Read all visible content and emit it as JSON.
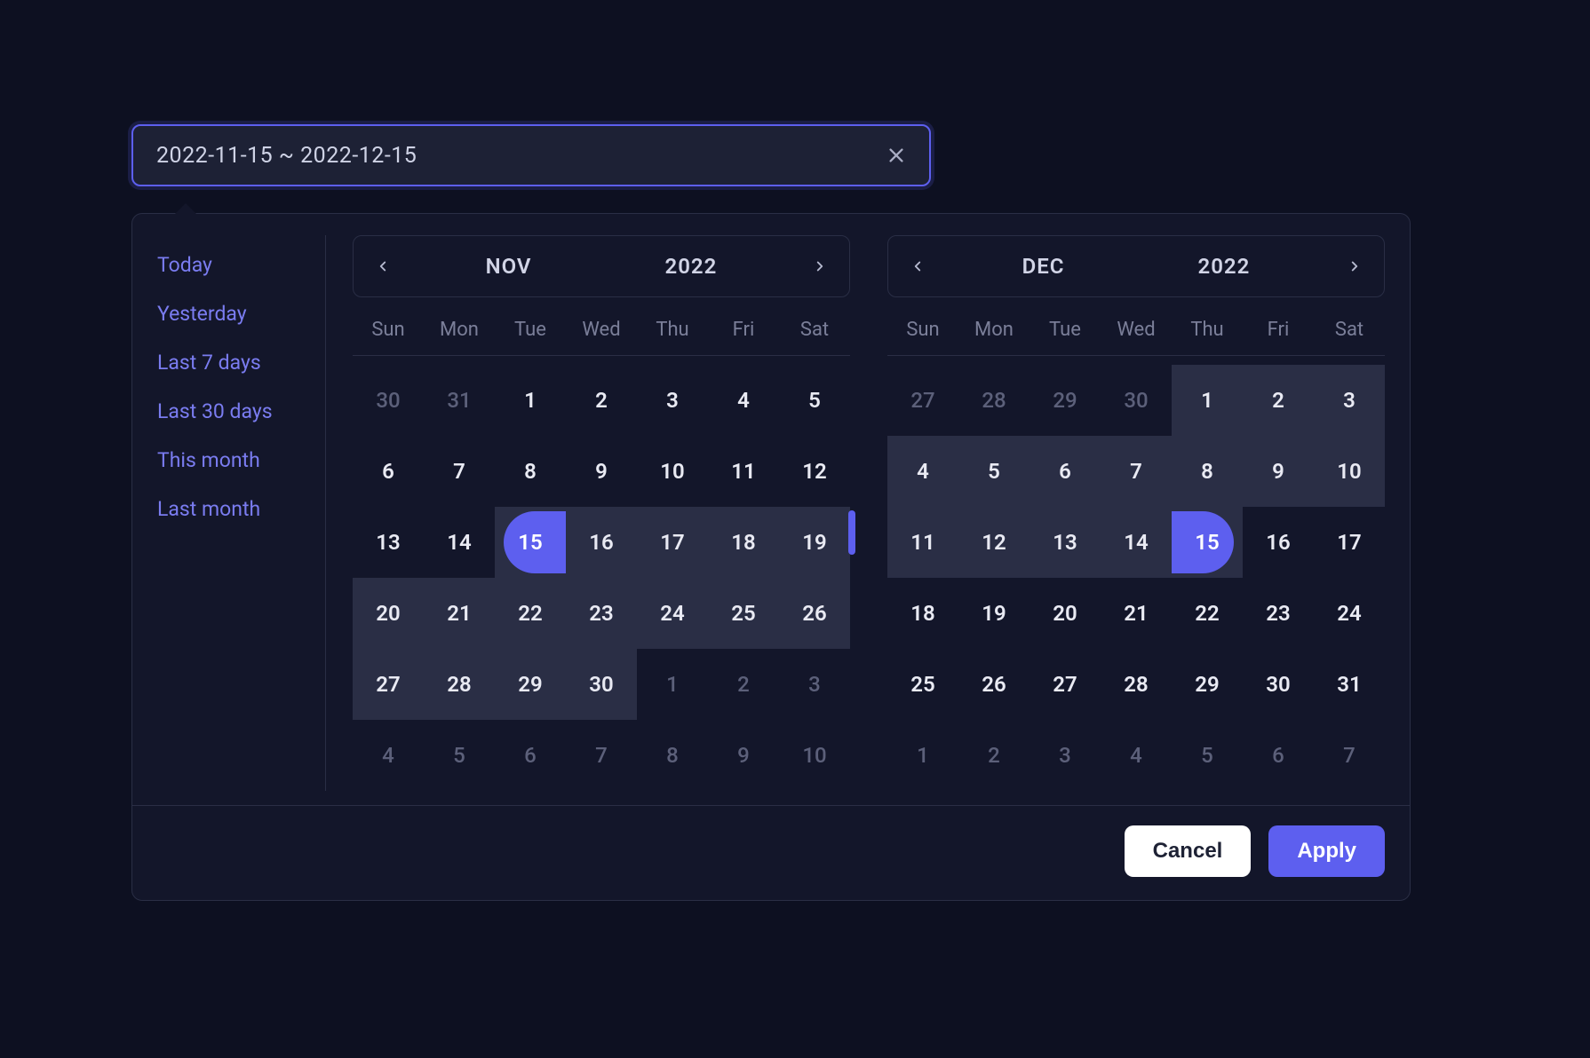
{
  "input": {
    "value": "2022-11-15 ~ 2022-12-15"
  },
  "shortcuts": [
    "Today",
    "Yesterday",
    "Last 7 days",
    "Last 30 days",
    "This month",
    "Last month"
  ],
  "leftCal": {
    "month": "NOV",
    "year": "2022",
    "dows": [
      "Sun",
      "Mon",
      "Tue",
      "Wed",
      "Thu",
      "Fri",
      "Sat"
    ],
    "cells": [
      {
        "n": 30,
        "out": true
      },
      {
        "n": 31,
        "out": true
      },
      {
        "n": 1
      },
      {
        "n": 2
      },
      {
        "n": 3
      },
      {
        "n": 4
      },
      {
        "n": 5
      },
      {
        "n": 6
      },
      {
        "n": 7
      },
      {
        "n": 8
      },
      {
        "n": 9
      },
      {
        "n": 10
      },
      {
        "n": 11
      },
      {
        "n": 12
      },
      {
        "n": 13
      },
      {
        "n": 14
      },
      {
        "n": 15,
        "selStart": true
      },
      {
        "n": 16,
        "range": true
      },
      {
        "n": 17,
        "range": true
      },
      {
        "n": 18,
        "range": true
      },
      {
        "n": 19,
        "range": true
      },
      {
        "n": 20,
        "range": true
      },
      {
        "n": 21,
        "range": true
      },
      {
        "n": 22,
        "range": true
      },
      {
        "n": 23,
        "range": true
      },
      {
        "n": 24,
        "range": true
      },
      {
        "n": 25,
        "range": true
      },
      {
        "n": 26,
        "range": true
      },
      {
        "n": 27,
        "range": true
      },
      {
        "n": 28,
        "range": true
      },
      {
        "n": 29,
        "range": true
      },
      {
        "n": 30,
        "range": true
      },
      {
        "n": 1,
        "out": true
      },
      {
        "n": 2,
        "out": true
      },
      {
        "n": 3,
        "out": true
      },
      {
        "n": 4,
        "out": true
      },
      {
        "n": 5,
        "out": true
      },
      {
        "n": 6,
        "out": true
      },
      {
        "n": 7,
        "out": true
      },
      {
        "n": 8,
        "out": true
      },
      {
        "n": 9,
        "out": true
      },
      {
        "n": 10,
        "out": true
      }
    ]
  },
  "rightCal": {
    "month": "DEC",
    "year": "2022",
    "dows": [
      "Sun",
      "Mon",
      "Tue",
      "Wed",
      "Thu",
      "Fri",
      "Sat"
    ],
    "cells": [
      {
        "n": 27,
        "out": true
      },
      {
        "n": 28,
        "out": true
      },
      {
        "n": 29,
        "out": true
      },
      {
        "n": 30,
        "out": true
      },
      {
        "n": 1,
        "range": true
      },
      {
        "n": 2,
        "range": true
      },
      {
        "n": 3,
        "range": true
      },
      {
        "n": 4,
        "range": true
      },
      {
        "n": 5,
        "range": true
      },
      {
        "n": 6,
        "range": true
      },
      {
        "n": 7,
        "range": true
      },
      {
        "n": 8,
        "range": true
      },
      {
        "n": 9,
        "range": true
      },
      {
        "n": 10,
        "range": true
      },
      {
        "n": 11,
        "range": true
      },
      {
        "n": 12,
        "range": true
      },
      {
        "n": 13,
        "range": true
      },
      {
        "n": 14,
        "range": true
      },
      {
        "n": 15,
        "selEnd": true
      },
      {
        "n": 16
      },
      {
        "n": 17
      },
      {
        "n": 18
      },
      {
        "n": 19
      },
      {
        "n": 20
      },
      {
        "n": 21
      },
      {
        "n": 22
      },
      {
        "n": 23
      },
      {
        "n": 24
      },
      {
        "n": 25
      },
      {
        "n": 26
      },
      {
        "n": 27
      },
      {
        "n": 28
      },
      {
        "n": 29
      },
      {
        "n": 30
      },
      {
        "n": 31
      },
      {
        "n": 1,
        "out": true
      },
      {
        "n": 2,
        "out": true
      },
      {
        "n": 3,
        "out": true
      },
      {
        "n": 4,
        "out": true
      },
      {
        "n": 5,
        "out": true
      },
      {
        "n": 6,
        "out": true
      },
      {
        "n": 7,
        "out": true
      }
    ]
  },
  "footer": {
    "cancel": "Cancel",
    "apply": "Apply"
  }
}
